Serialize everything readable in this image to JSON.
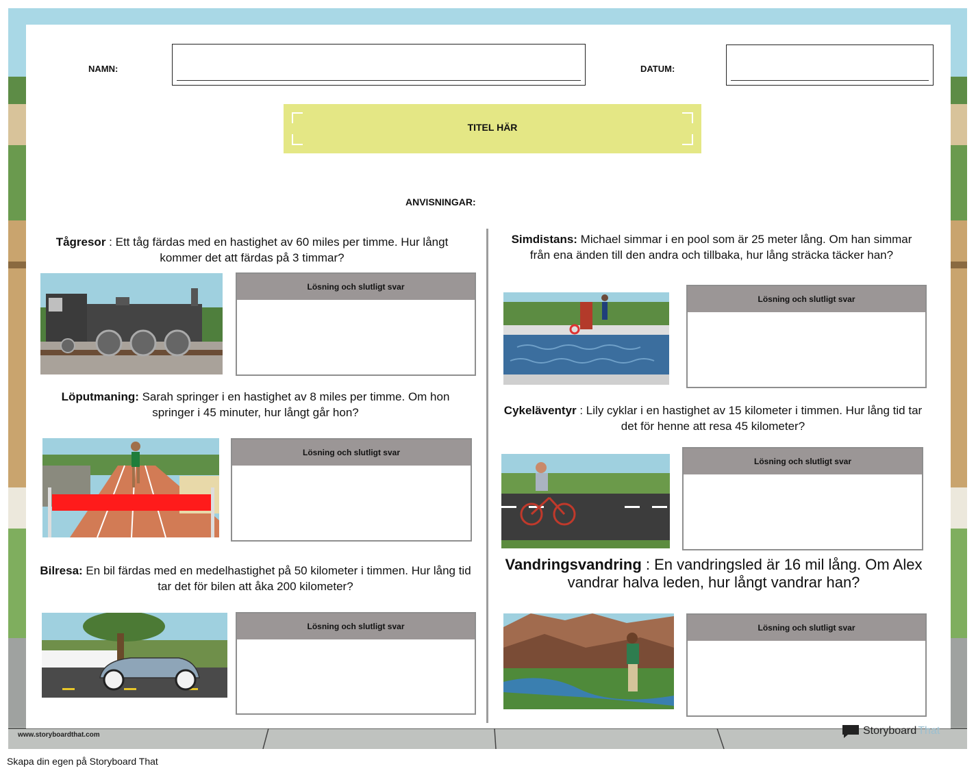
{
  "header": {
    "name_label": "NAMN:",
    "date_label": "DATUM:",
    "title_placeholder": "TITEL HÄR",
    "instructions_label": "ANVISNINGAR:"
  },
  "answer_header": "Lösning och slutligt svar",
  "problems": [
    {
      "title": "Tågresor",
      "text": " : Ett tåg färdas med en hastighet av 60 miles per timme. Hur långt kommer det att färdas på 3 timmar?",
      "image": "steam-train-illustration"
    },
    {
      "title": "Löputmaning:",
      "text": " Sarah springer i en hastighet av 8 miles per timme. Om hon springer i 45 minuter, hur långt går hon?",
      "image": "running-track-illustration"
    },
    {
      "title": "Bilresa:",
      "text": " En bil färdas med en medelhastighet på 50 kilometer i timmen. Hur lång tid tar det för bilen att åka 200 kilometer?",
      "image": "vintage-car-illustration"
    },
    {
      "title": "Simdistans:",
      "text": " Michael simmar i en pool som är 25 meter lång. Om han simmar från ena änden till den andra och tillbaka, hur lång sträcka täcker han?",
      "image": "swimming-pool-illustration"
    },
    {
      "title": "Cykeläventyr",
      "text": " : Lily cyklar i en hastighet av 15 kilometer i timmen. Hur lång tid tar det för henne att resa 45 kilometer?",
      "image": "cyclist-road-illustration"
    },
    {
      "title": "Vandringsvandring",
      "text": " : En vandringsled är 16 mil lång. Om Alex vandrar halva leden, hur långt vandrar han?",
      "image": "hiker-canyon-illustration"
    }
  ],
  "footer": {
    "site_url": "www.storyboardthat.com",
    "brand": "Storyboard",
    "brand_suffix": "That",
    "cta": "Skapa din egen på Storyboard That"
  },
  "colors": {
    "title_bg": "#e4e785",
    "answer_header_bg": "#9b9696",
    "sky": "#a9d8e6",
    "grass": "#6a9a4e"
  }
}
